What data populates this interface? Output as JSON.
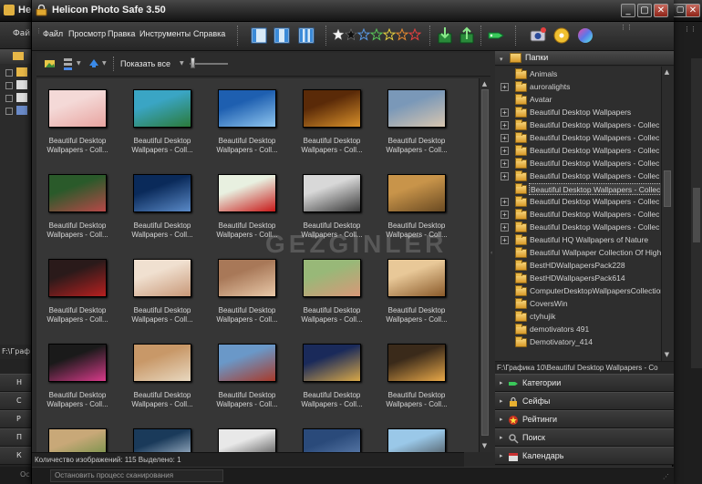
{
  "background_window": {
    "title": "He",
    "menu_label": "Фай",
    "sidebar_labels": [
      "Н",
      "С",
      "Р",
      "П",
      "К"
    ],
    "path_fragment": "F:\\Граф",
    "status_fragment": "Ос"
  },
  "window": {
    "title": "Helicon Photo Safe 3.50"
  },
  "menu": {
    "items": [
      "Файл",
      "Просмотр",
      "Правка",
      "Инструменты",
      "Справка"
    ]
  },
  "toolbar": {
    "rating_stars": [
      "white",
      "black",
      "blue",
      "green",
      "yellow",
      "orange",
      "red"
    ],
    "buttons": [
      "layout-1-icon",
      "layout-2-icon",
      "layout-3-icon",
      "import-icon",
      "export-icon",
      "tag-icon",
      "camera-icon",
      "disc-icon",
      "gradient-icon"
    ]
  },
  "grid_toolbar": {
    "show_label": "Показать все"
  },
  "thumbnails": [
    {
      "line1": "Beautiful Desktop",
      "line2": "Wallpapers - Coll...",
      "colors": [
        "#f4d9d7",
        "#e8a4a0"
      ]
    },
    {
      "line1": "Beautiful Desktop",
      "line2": "Wallpapers - Coll...",
      "colors": [
        "#3aa5c4",
        "#2b7a3a"
      ]
    },
    {
      "line1": "Beautiful Desktop",
      "line2": "Wallpapers - Coll...",
      "colors": [
        "#1e5fb0",
        "#8fc6ef"
      ]
    },
    {
      "line1": "Beautiful Desktop",
      "line2": "Wallpapers - Coll...",
      "colors": [
        "#5a2a08",
        "#d8902a"
      ]
    },
    {
      "line1": "Beautiful Desktop",
      "line2": "Wallpapers - Coll...",
      "colors": [
        "#7a98b8",
        "#d8c6b0"
      ]
    },
    {
      "line1": "Beautiful Desktop",
      "line2": "Wallpapers - Coll...",
      "colors": [
        "#2a5a2a",
        "#b84848"
      ]
    },
    {
      "line1": "Beautiful Desktop",
      "line2": "Wallpapers - Coll...",
      "colors": [
        "#0a2a5a",
        "#5a8ac8"
      ]
    },
    {
      "line1": "Beautiful Desktop",
      "line2": "Wallpapers - Coll...",
      "colors": [
        "#e8f0e0",
        "#c81818"
      ]
    },
    {
      "line1": "Beautiful Desktop",
      "line2": "Wallpapers - Coll...",
      "colors": [
        "#d8d8d8",
        "#3a3a3a"
      ]
    },
    {
      "line1": "Beautiful Desktop",
      "line2": "Wallpapers - Coll...",
      "colors": [
        "#c8944a",
        "#6a4a22"
      ]
    },
    {
      "line1": "Beautiful Desktop",
      "line2": "Wallpapers - Coll...",
      "colors": [
        "#2a1a1a",
        "#b82020"
      ]
    },
    {
      "line1": "Beautiful Desktop",
      "line2": "Wallpapers - Coll...",
      "colors": [
        "#f0e0d0",
        "#c89878"
      ]
    },
    {
      "line1": "Beautiful Desktop",
      "line2": "Wallpapers - Coll...",
      "colors": [
        "#a87858",
        "#e8c8a8"
      ]
    },
    {
      "line1": "Beautiful Desktop",
      "line2": "Wallpapers - Coll...",
      "colors": [
        "#98b878",
        "#d89878"
      ]
    },
    {
      "line1": "Beautiful Desktop",
      "line2": "Wallpapers - Coll...",
      "colors": [
        "#e8c898",
        "#8a5a2a"
      ]
    },
    {
      "line1": "Beautiful Desktop",
      "line2": "Wallpapers - Coll...",
      "colors": [
        "#1a1a1a",
        "#d83a8a"
      ]
    },
    {
      "line1": "Beautiful Desktop",
      "line2": "Wallpapers - Coll...",
      "colors": [
        "#c89868",
        "#e8d8c0"
      ]
    },
    {
      "line1": "Beautiful Desktop",
      "line2": "Wallpapers - Coll...",
      "colors": [
        "#6a98c8",
        "#a83a2a"
      ]
    },
    {
      "line1": "Beautiful Desktop",
      "line2": "Wallpapers - Coll...",
      "colors": [
        "#1a2a5a",
        "#d8a848"
      ]
    },
    {
      "line1": "Beautiful Desktop",
      "line2": "Wallpapers - Coll...",
      "colors": [
        "#3a2a1a",
        "#e8a848"
      ]
    },
    {
      "line1": "",
      "line2": "",
      "colors": [
        "#c8a878",
        "#5a8a3a"
      ]
    },
    {
      "line1": "",
      "line2": "",
      "colors": [
        "#1a3a5a",
        "#c8d8e8"
      ]
    },
    {
      "line1": "",
      "line2": "",
      "colors": [
        "#e8e8e8",
        "#2a2a2a"
      ]
    },
    {
      "line1": "",
      "line2": "",
      "colors": [
        "#2a4a7a",
        "#6a8ab8"
      ]
    },
    {
      "line1": "",
      "line2": "",
      "colors": [
        "#9ac8e8",
        "#3a3a3a"
      ]
    }
  ],
  "folders": {
    "header": "Папки",
    "items": [
      {
        "name": "Animals",
        "expandable": false,
        "selected": false
      },
      {
        "name": "auroralights",
        "expandable": true,
        "selected": false
      },
      {
        "name": "Avatar",
        "expandable": false,
        "selected": false
      },
      {
        "name": "Beautiful Desktop Wallpapers",
        "expandable": true,
        "selected": false
      },
      {
        "name": "Beautiful Desktop Wallpapers - Collec",
        "expandable": true,
        "selected": false
      },
      {
        "name": "Beautiful Desktop Wallpapers - Collec",
        "expandable": true,
        "selected": false
      },
      {
        "name": "Beautiful Desktop Wallpapers - Collec",
        "expandable": true,
        "selected": false
      },
      {
        "name": "Beautiful Desktop Wallpapers - Collec",
        "expandable": true,
        "selected": false
      },
      {
        "name": "Beautiful Desktop Wallpapers - Collec",
        "expandable": true,
        "selected": false
      },
      {
        "name": "Beautiful Desktop Wallpapers - Collec",
        "expandable": false,
        "selected": true
      },
      {
        "name": "Beautiful Desktop Wallpapers - Collec",
        "expandable": true,
        "selected": false
      },
      {
        "name": "Beautiful Desktop Wallpapers - Collec",
        "expandable": true,
        "selected": false
      },
      {
        "name": "Beautiful Desktop Wallpapers - Collec",
        "expandable": true,
        "selected": false
      },
      {
        "name": "Beautiful HQ Wallpapers of Nature",
        "expandable": true,
        "selected": false
      },
      {
        "name": "Beautiful Wallpaper Collection Of High",
        "expandable": false,
        "selected": false
      },
      {
        "name": "BestHDWallpapersPack228",
        "expandable": false,
        "selected": false
      },
      {
        "name": "BestHDWallpapersPack614",
        "expandable": false,
        "selected": false
      },
      {
        "name": "ComputerDesktopWallpapersCollection",
        "expandable": false,
        "selected": false
      },
      {
        "name": "CoversWin",
        "expandable": false,
        "selected": false
      },
      {
        "name": "ctyhujik",
        "expandable": false,
        "selected": false
      },
      {
        "name": "demotivators 491",
        "expandable": false,
        "selected": false
      },
      {
        "name": "Demotivatory_414",
        "expandable": false,
        "selected": false
      }
    ]
  },
  "path_bar": "F:\\Графика 10\\Beautiful Desktop Wallpapers - Co",
  "sections": [
    {
      "label": "Категории",
      "icon": "category-icon"
    },
    {
      "label": "Сейфы",
      "icon": "lock-icon"
    },
    {
      "label": "Рейтинги",
      "icon": "star-badge-icon"
    },
    {
      "label": "Поиск",
      "icon": "search-icon"
    },
    {
      "label": "Календарь",
      "icon": "calendar-icon"
    }
  ],
  "status": {
    "counts": "Количество изображений: 115 Выделено: 1",
    "stop_scan": "Остановить процесс сканирования"
  },
  "watermark": "GEZGINLER",
  "colors": {
    "accent": "#f6c85a",
    "background": "#2a2a2a"
  }
}
